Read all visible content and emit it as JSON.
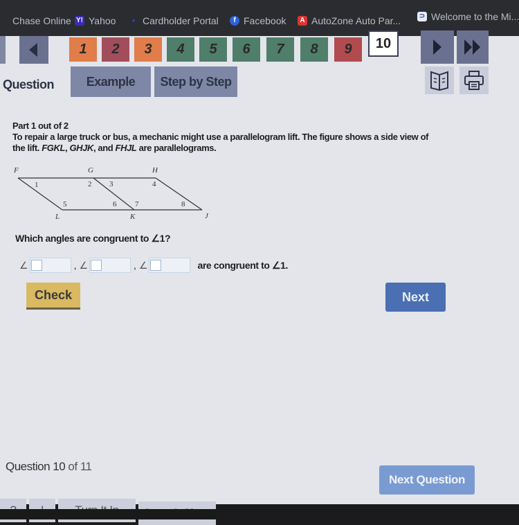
{
  "bookmarks": [
    {
      "label": "Chase Online",
      "icon": "none"
    },
    {
      "label": "Yahoo",
      "icon": "yahoo-icon"
    },
    {
      "label": "Cardholder Portal",
      "icon": "dot-icon"
    },
    {
      "label": "Facebook",
      "icon": "facebook-icon"
    },
    {
      "label": "AutoZone Auto Par...",
      "icon": "autozone-icon"
    },
    {
      "label": "Welcome to the Mi...",
      "icon": "bookmark-site-icon"
    }
  ],
  "question_nav": {
    "tiles": [
      {
        "label": "1",
        "status": "incorrect-partial",
        "color": "#e07d4a"
      },
      {
        "label": "2",
        "status": "incorrect",
        "color": "#a24d5c"
      },
      {
        "label": "3",
        "status": "incorrect-partial",
        "color": "#e07d4a"
      },
      {
        "label": "4",
        "status": "correct",
        "color": "#4f7e6a"
      },
      {
        "label": "5",
        "status": "correct",
        "color": "#4f7e6a"
      },
      {
        "label": "6",
        "status": "correct",
        "color": "#4f7e6a"
      },
      {
        "label": "7",
        "status": "correct",
        "color": "#4f7e6a"
      },
      {
        "label": "8",
        "status": "correct",
        "color": "#4f7e6a"
      },
      {
        "label": "9",
        "status": "incorrect",
        "color": "#b24b4f"
      },
      {
        "label": "10",
        "status": "current",
        "color": "#ffffff"
      }
    ]
  },
  "tabs": {
    "question": "Question",
    "example": "Example",
    "step_by_step": "Step by Step"
  },
  "problem": {
    "part": "Part 1 out of 2",
    "text_line1": "To repair a large truck or bus, a mechanic might use a parallelogram lift. The figure shows a side view of",
    "text_line2_prefix": "the lift. ",
    "shapes": [
      "FGKL",
      "GHJK",
      "FHJL"
    ],
    "text_line2_suffix": " are parallelograms.",
    "figure": {
      "points": {
        "F": "F",
        "G": "G",
        "H": "H",
        "L": "L",
        "K": "K",
        "J": "J"
      },
      "angles": [
        "1",
        "2",
        "3",
        "4",
        "5",
        "6",
        "7",
        "8"
      ]
    },
    "prompt": "Which angles are congruent to ∠1?",
    "answer_symbol": "∠",
    "answer_suffix": "are congruent to ∠1.",
    "answers": [
      "",
      "",
      ""
    ]
  },
  "buttons": {
    "check": "Check",
    "next": "Next",
    "next_question": "Next Question"
  },
  "footer": {
    "question_label": "Question 10",
    "question_of": "of 11",
    "help": "?",
    "info": "!",
    "turn_it_in": "Turn It In",
    "save_close": "Save & Close"
  }
}
